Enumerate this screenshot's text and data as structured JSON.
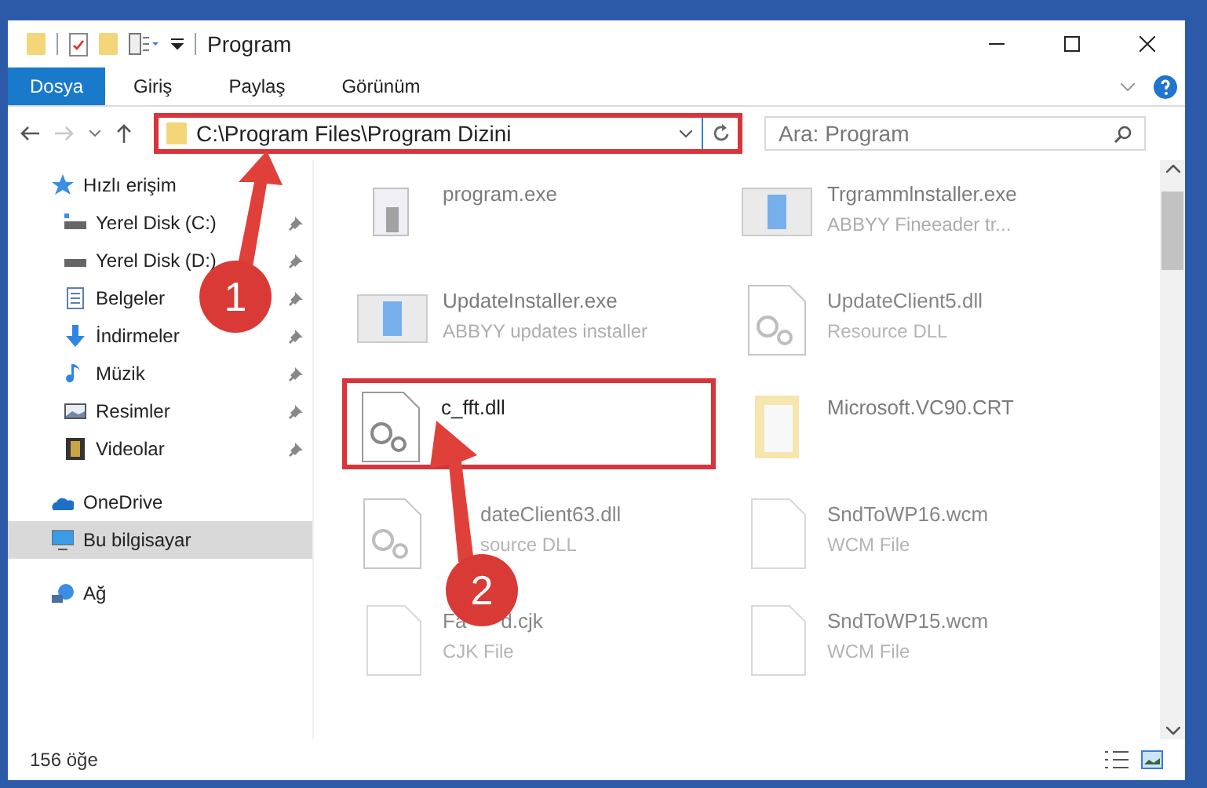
{
  "window": {
    "title": "Program"
  },
  "ribbon_tabs": [
    {
      "label": "Dosya",
      "selected": true
    },
    {
      "label": "Giriş",
      "selected": false
    },
    {
      "label": "Paylaş",
      "selected": false
    },
    {
      "label": "Görünüm",
      "selected": false
    }
  ],
  "address": {
    "value": "C:\\Program Files\\Program Dizini",
    "highlighted": true
  },
  "search": {
    "placeholder": "Ara: Program"
  },
  "sidebar": {
    "items": [
      {
        "label": "Hızlı erişim",
        "kind": "star",
        "pinned": false,
        "selected": false
      },
      {
        "label": "Yerel Disk (C:)",
        "kind": "drive-c",
        "pinned": true,
        "selected": false
      },
      {
        "label": "Yerel Disk (D:)",
        "kind": "drive",
        "pinned": true,
        "selected": false
      },
      {
        "label": "Belgeler",
        "kind": "doc",
        "pinned": true,
        "selected": false
      },
      {
        "label": "İndirmeler",
        "kind": "download",
        "pinned": true,
        "selected": false
      },
      {
        "label": "Müzik",
        "kind": "music",
        "pinned": true,
        "selected": false
      },
      {
        "label": "Resimler",
        "kind": "picture",
        "pinned": true,
        "selected": false
      },
      {
        "label": "Videolar",
        "kind": "video",
        "pinned": true,
        "selected": false
      },
      {
        "label": "OneDrive",
        "kind": "cloud",
        "pinned": false,
        "selected": false
      },
      {
        "label": "Bu bilgisayar",
        "kind": "pc",
        "pinned": false,
        "selected": true
      },
      {
        "label": "Ağ",
        "kind": "network",
        "pinned": false,
        "selected": false
      }
    ]
  },
  "files": [
    {
      "name": "program.exe",
      "kind": "exe",
      "highlighted": false
    },
    {
      "name": "Trgrammlnstaller.exe",
      "type": "ABBYY Fineeader tr...",
      "kind": "window",
      "highlighted": false
    },
    {
      "name": "UpdateInstaller.exe",
      "type": "ABBYY updates installer",
      "kind": "window",
      "highlighted": false
    },
    {
      "name": "UpdateClient5.dll",
      "type": "Resource DLL",
      "kind": "dll",
      "highlighted": false
    },
    {
      "name": "c_fft.dll",
      "kind": "dll",
      "highlighted": true
    },
    {
      "name": "Microsoft.VC90.CRT",
      "kind": "folder",
      "highlighted": false
    },
    {
      "name": "dateClient63.dll",
      "type": "source DLL",
      "kind": "dll",
      "highlighted": false,
      "start_covered": true
    },
    {
      "name": "SndToWP16.wcm",
      "type": "WCM File",
      "kind": "blank",
      "highlighted": false
    },
    {
      "name_parts": [
        "Fa",
        "d.cjk"
      ],
      "type": "CJK File",
      "kind": "blank",
      "highlighted": false
    },
    {
      "name": "SndToWP15.wcm",
      "type": "WCM File",
      "kind": "blank",
      "highlighted": false
    }
  ],
  "status_bar": {
    "count": "156 öğe"
  },
  "annotations": [
    {
      "number": "1"
    },
    {
      "number": "2"
    }
  ]
}
